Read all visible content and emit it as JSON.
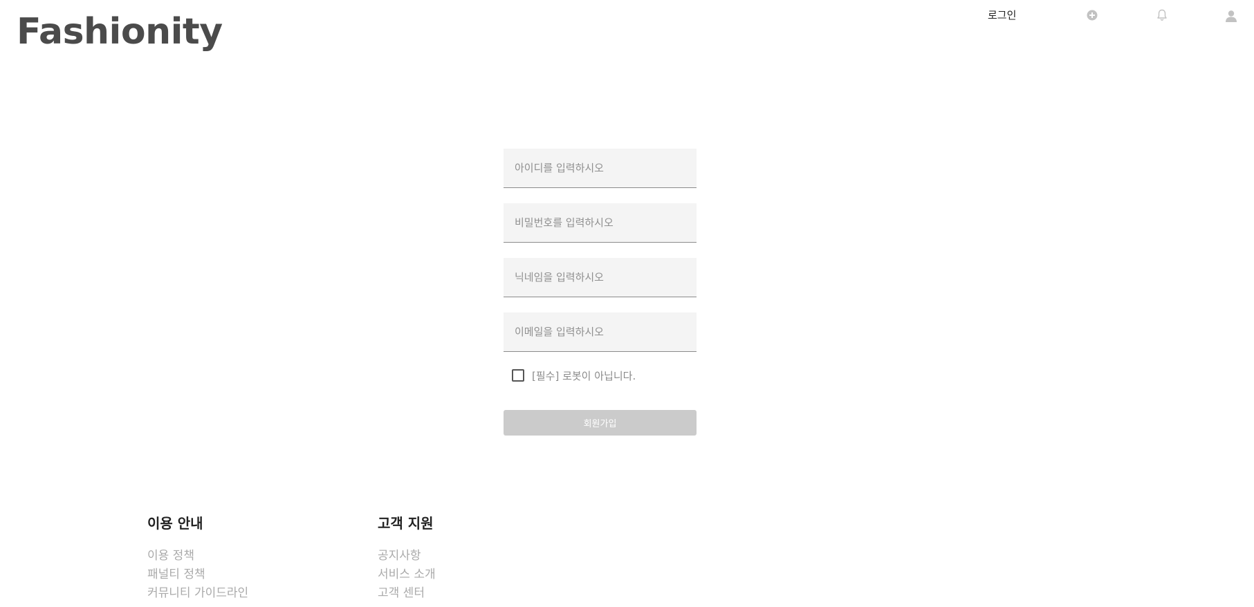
{
  "header": {
    "logo": "Fashionity",
    "login_label": "로그인",
    "icons": [
      "add-circle-icon",
      "bell-icon",
      "user-icon"
    ],
    "icon_color": "#c2c2c2"
  },
  "form": {
    "id_placeholder": "아이디를 입력하시오",
    "password_placeholder": "비밀번호를 입력하시오",
    "nickname_placeholder": "닉네임을 입력하시오",
    "email_placeholder": "이메일을 입력하시오",
    "robot_check_label": "[필수] 로봇이 아닙니다.",
    "robot_checked": false,
    "signup_label": "회원가입",
    "signup_color": "#cbcbcb"
  },
  "footer": {
    "usage": {
      "heading": "이용 안내",
      "links": [
        "이용 정책",
        "패널티 정책",
        "커뮤니티 가이드라인"
      ]
    },
    "support": {
      "heading": "고객 지원",
      "links": [
        "공지사항",
        "서비스 소개",
        "고객 센터"
      ]
    }
  }
}
